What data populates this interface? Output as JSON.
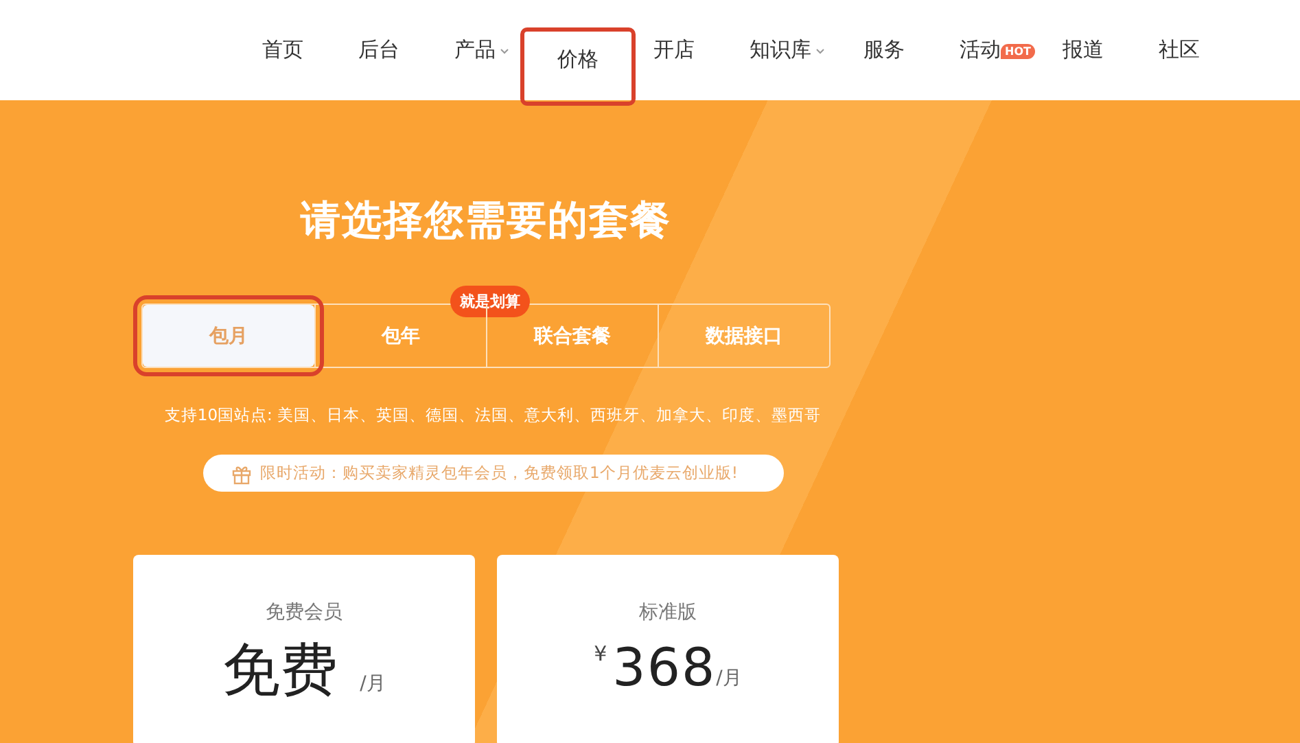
{
  "nav": {
    "items": [
      {
        "label": "首页",
        "dropdown": false,
        "highlighted": false
      },
      {
        "label": "后台",
        "dropdown": false,
        "highlighted": false
      },
      {
        "label": "产品",
        "dropdown": true,
        "highlighted": false
      },
      {
        "label": "价格",
        "dropdown": false,
        "highlighted": true
      },
      {
        "label": "开店",
        "dropdown": false,
        "highlighted": false
      },
      {
        "label": "知识库",
        "dropdown": true,
        "highlighted": false
      },
      {
        "label": "服务",
        "dropdown": false,
        "highlighted": false
      },
      {
        "label": "活动",
        "dropdown": false,
        "highlighted": false,
        "badge": "HOT"
      },
      {
        "label": "报道",
        "dropdown": false,
        "highlighted": false
      },
      {
        "label": "社区",
        "dropdown": false,
        "highlighted": false
      }
    ]
  },
  "hero": {
    "title": "请选择您需要的套餐",
    "tabs": [
      {
        "label": "包月",
        "selected": true,
        "highlighted": true
      },
      {
        "label": "包年",
        "selected": false,
        "highlighted": false,
        "badge": "就是划算"
      },
      {
        "label": "联合套餐",
        "selected": false,
        "highlighted": false
      },
      {
        "label": "数据接口",
        "selected": false,
        "highlighted": false
      }
    ],
    "sites": "支持10国站点: 美国、日本、英国、德国、法国、意大利、西班牙、加拿大、印度、墨西哥",
    "promo": "限时活动：购买卖家精灵包年会员，免费领取1个月优麦云创业版!"
  },
  "plans": [
    {
      "name": "免费会员",
      "price": "免费",
      "period": "/月",
      "kind": "text"
    },
    {
      "name": "标准版",
      "currency": "¥",
      "price": "368",
      "period": "/月",
      "kind": "number"
    }
  ]
}
